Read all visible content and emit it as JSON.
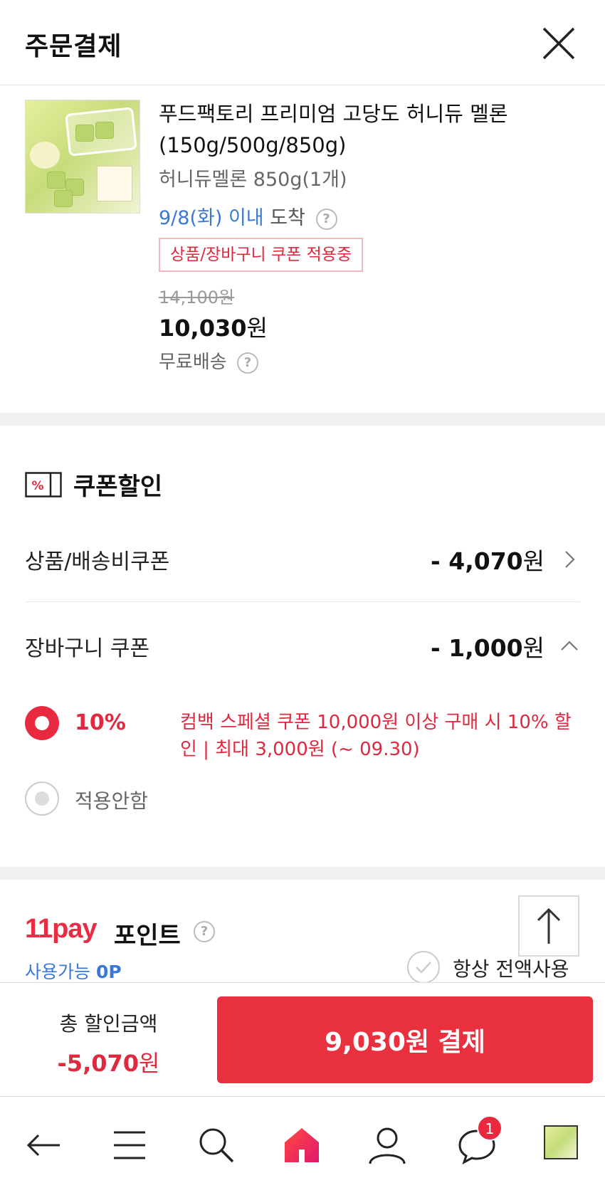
{
  "header": {
    "title": "주문결제"
  },
  "product": {
    "name": "푸드팩토리 프리미엄 고당도 허니듀 멜론 (150g/500g/850g)",
    "option": "허니듀멜론 850g(1개)",
    "arrive_date": "9/8(화) 이내",
    "arrive_suffix": "도착",
    "coupon_badge": "상품/장바구니 쿠폰 적용중",
    "original_price": "14,100원",
    "price_number": "10,030",
    "price_unit": "원",
    "shipping": "무료배송"
  },
  "coupon": {
    "title": "쿠폰할인",
    "rows": [
      {
        "label": "상품/배송비쿠폰",
        "value": "- 4,070",
        "unit": "원"
      },
      {
        "label": "장바구니 쿠폰",
        "value": "- 1,000",
        "unit": "원"
      }
    ],
    "selected_percent": "10%",
    "selected_desc": "컴백 스페셜 쿠폰 10,000원 이상 구매 시 10% 할인 | 최대 3,000원 (~ 09.30)",
    "no_apply_label": "적용안함"
  },
  "points": {
    "logo": "11pay",
    "title": "포인트",
    "available_label": "사용가능",
    "available_value": "0P",
    "always_full": "항상 전액사용"
  },
  "pay_bar": {
    "total_label": "총 할인금액",
    "total_value": "-5,070",
    "total_unit": "원",
    "pay_button": "9,030원 결제"
  },
  "nav": {
    "chat_badge": "1"
  },
  "colors": {
    "accent": "#e8303f",
    "link": "#3a78d4"
  }
}
